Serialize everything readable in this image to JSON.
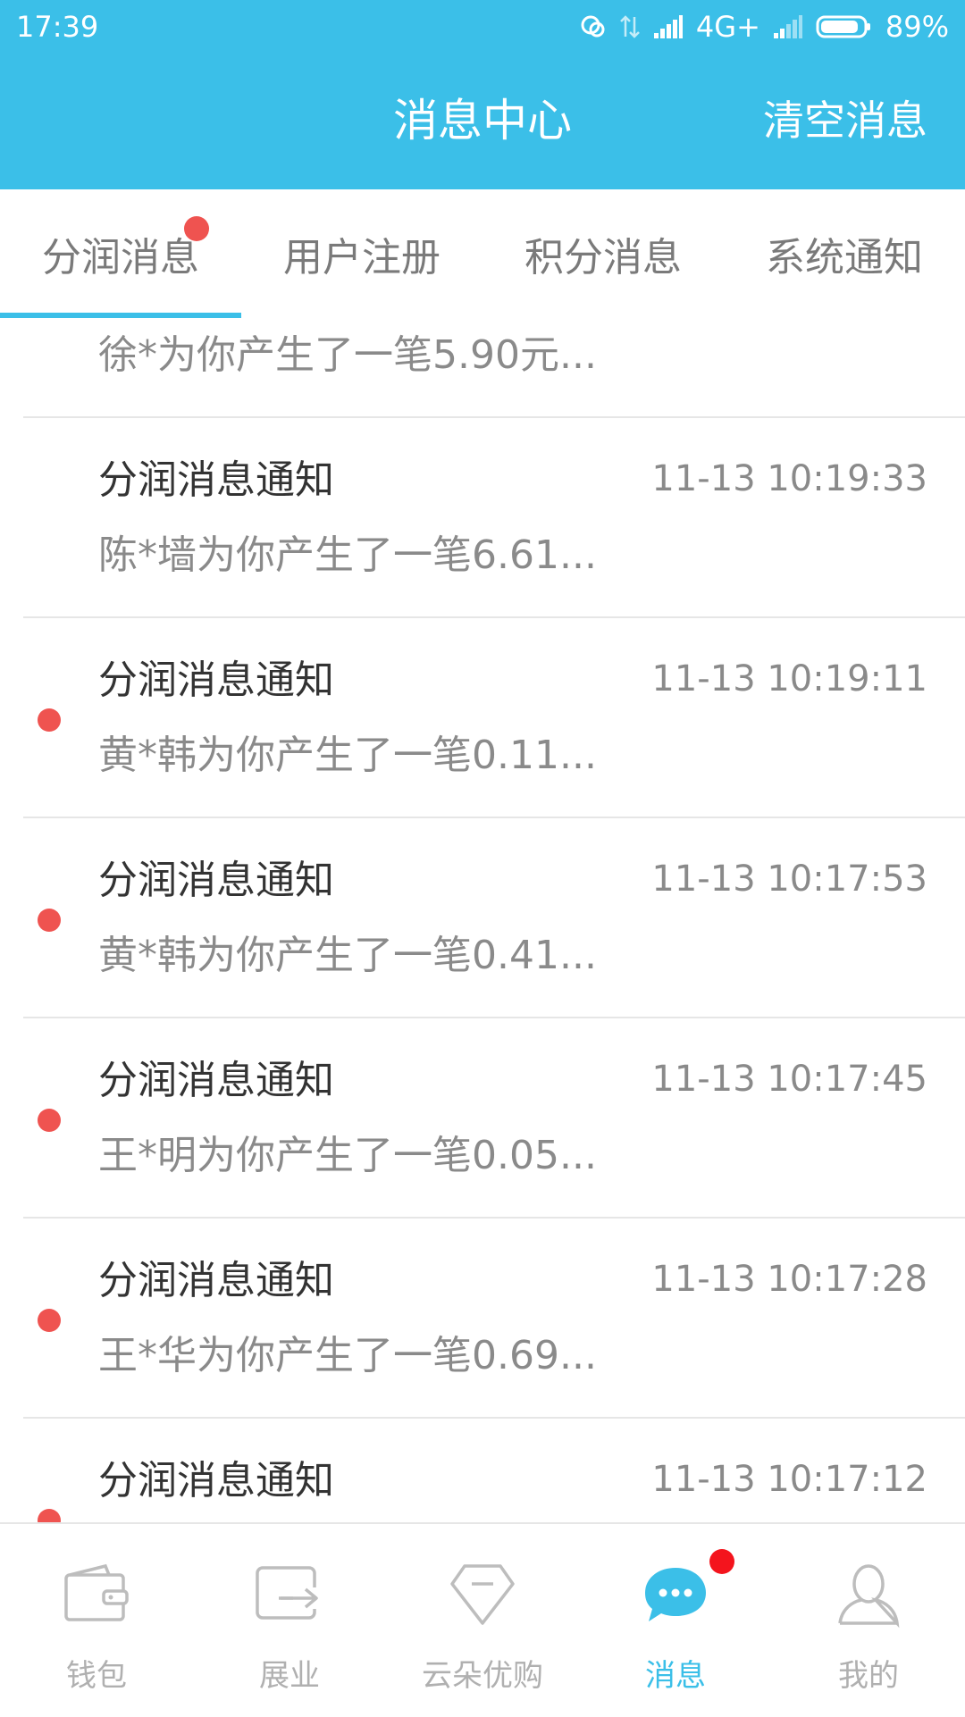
{
  "status_bar": {
    "time": "17:39",
    "network": "4G+",
    "battery": "89%",
    "battery_level": 0.89
  },
  "header": {
    "title": "消息中心",
    "clear_label": "清空消息"
  },
  "tabs": [
    {
      "label": "分润消息",
      "active": true,
      "has_badge": true
    },
    {
      "label": "用户注册",
      "active": false,
      "has_badge": false
    },
    {
      "label": "积分消息",
      "active": false,
      "has_badge": false
    },
    {
      "label": "系统通知",
      "active": false,
      "has_badge": false
    }
  ],
  "messages": [
    {
      "title": "",
      "time": "",
      "preview": "徐*为你产生了一笔5.90元...",
      "unread": true
    },
    {
      "title": "分润消息通知",
      "time": "11-13 10:19:33",
      "preview": "陈*墙为你产生了一笔6.61...",
      "unread": false
    },
    {
      "title": "分润消息通知",
      "time": "11-13 10:19:11",
      "preview": "黄*韩为你产生了一笔0.11...",
      "unread": true
    },
    {
      "title": "分润消息通知",
      "time": "11-13 10:17:53",
      "preview": "黄*韩为你产生了一笔0.41...",
      "unread": true
    },
    {
      "title": "分润消息通知",
      "time": "11-13 10:17:45",
      "preview": "王*明为你产生了一笔0.05...",
      "unread": true
    },
    {
      "title": "分润消息通知",
      "time": "11-13 10:17:28",
      "preview": "王*华为你产生了一笔0.69...",
      "unread": true
    },
    {
      "title": "分润消息通知",
      "time": "11-13 10:17:12",
      "preview": "",
      "unread": true
    }
  ],
  "bottom_nav": [
    {
      "label": "钱包",
      "icon": "wallet-icon",
      "active": false
    },
    {
      "label": "展业",
      "icon": "share-icon",
      "active": false
    },
    {
      "label": "云朵优购",
      "icon": "diamond-icon",
      "active": false
    },
    {
      "label": "消息",
      "icon": "chat-bubble-icon",
      "active": true,
      "has_badge": true
    },
    {
      "label": "我的",
      "icon": "user-icon",
      "active": false
    }
  ],
  "colors": {
    "accent": "#3bbfe8",
    "unread_dot": "#ef5350",
    "nav_badge": "#f4141d"
  }
}
